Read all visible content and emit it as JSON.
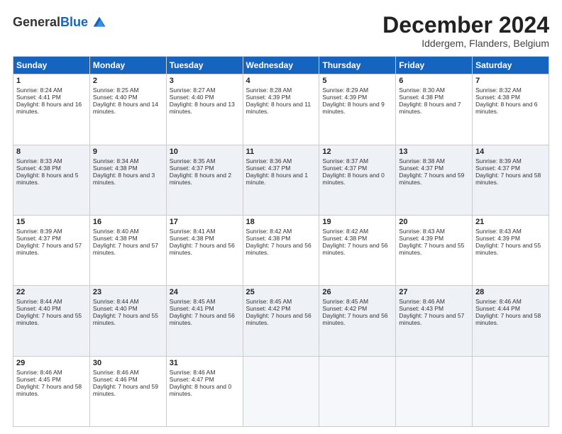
{
  "logo": {
    "line1": "General",
    "line2": "Blue"
  },
  "header": {
    "month": "December 2024",
    "location": "Iddergem, Flanders, Belgium"
  },
  "days_of_week": [
    "Sunday",
    "Monday",
    "Tuesday",
    "Wednesday",
    "Thursday",
    "Friday",
    "Saturday"
  ],
  "weeks": [
    [
      {
        "day": "1",
        "sunrise": "Sunrise: 8:24 AM",
        "sunset": "Sunset: 4:41 PM",
        "daylight": "Daylight: 8 hours and 16 minutes."
      },
      {
        "day": "2",
        "sunrise": "Sunrise: 8:25 AM",
        "sunset": "Sunset: 4:40 PM",
        "daylight": "Daylight: 8 hours and 14 minutes."
      },
      {
        "day": "3",
        "sunrise": "Sunrise: 8:27 AM",
        "sunset": "Sunset: 4:40 PM",
        "daylight": "Daylight: 8 hours and 13 minutes."
      },
      {
        "day": "4",
        "sunrise": "Sunrise: 8:28 AM",
        "sunset": "Sunset: 4:39 PM",
        "daylight": "Daylight: 8 hours and 11 minutes."
      },
      {
        "day": "5",
        "sunrise": "Sunrise: 8:29 AM",
        "sunset": "Sunset: 4:39 PM",
        "daylight": "Daylight: 8 hours and 9 minutes."
      },
      {
        "day": "6",
        "sunrise": "Sunrise: 8:30 AM",
        "sunset": "Sunset: 4:38 PM",
        "daylight": "Daylight: 8 hours and 7 minutes."
      },
      {
        "day": "7",
        "sunrise": "Sunrise: 8:32 AM",
        "sunset": "Sunset: 4:38 PM",
        "daylight": "Daylight: 8 hours and 6 minutes."
      }
    ],
    [
      {
        "day": "8",
        "sunrise": "Sunrise: 8:33 AM",
        "sunset": "Sunset: 4:38 PM",
        "daylight": "Daylight: 8 hours and 5 minutes."
      },
      {
        "day": "9",
        "sunrise": "Sunrise: 8:34 AM",
        "sunset": "Sunset: 4:38 PM",
        "daylight": "Daylight: 8 hours and 3 minutes."
      },
      {
        "day": "10",
        "sunrise": "Sunrise: 8:35 AM",
        "sunset": "Sunset: 4:37 PM",
        "daylight": "Daylight: 8 hours and 2 minutes."
      },
      {
        "day": "11",
        "sunrise": "Sunrise: 8:36 AM",
        "sunset": "Sunset: 4:37 PM",
        "daylight": "Daylight: 8 hours and 1 minute."
      },
      {
        "day": "12",
        "sunrise": "Sunrise: 8:37 AM",
        "sunset": "Sunset: 4:37 PM",
        "daylight": "Daylight: 8 hours and 0 minutes."
      },
      {
        "day": "13",
        "sunrise": "Sunrise: 8:38 AM",
        "sunset": "Sunset: 4:37 PM",
        "daylight": "Daylight: 7 hours and 59 minutes."
      },
      {
        "day": "14",
        "sunrise": "Sunrise: 8:39 AM",
        "sunset": "Sunset: 4:37 PM",
        "daylight": "Daylight: 7 hours and 58 minutes."
      }
    ],
    [
      {
        "day": "15",
        "sunrise": "Sunrise: 8:39 AM",
        "sunset": "Sunset: 4:37 PM",
        "daylight": "Daylight: 7 hours and 57 minutes."
      },
      {
        "day": "16",
        "sunrise": "Sunrise: 8:40 AM",
        "sunset": "Sunset: 4:38 PM",
        "daylight": "Daylight: 7 hours and 57 minutes."
      },
      {
        "day": "17",
        "sunrise": "Sunrise: 8:41 AM",
        "sunset": "Sunset: 4:38 PM",
        "daylight": "Daylight: 7 hours and 56 minutes."
      },
      {
        "day": "18",
        "sunrise": "Sunrise: 8:42 AM",
        "sunset": "Sunset: 4:38 PM",
        "daylight": "Daylight: 7 hours and 56 minutes."
      },
      {
        "day": "19",
        "sunrise": "Sunrise: 8:42 AM",
        "sunset": "Sunset: 4:38 PM",
        "daylight": "Daylight: 7 hours and 56 minutes."
      },
      {
        "day": "20",
        "sunrise": "Sunrise: 8:43 AM",
        "sunset": "Sunset: 4:39 PM",
        "daylight": "Daylight: 7 hours and 55 minutes."
      },
      {
        "day": "21",
        "sunrise": "Sunrise: 8:43 AM",
        "sunset": "Sunset: 4:39 PM",
        "daylight": "Daylight: 7 hours and 55 minutes."
      }
    ],
    [
      {
        "day": "22",
        "sunrise": "Sunrise: 8:44 AM",
        "sunset": "Sunset: 4:40 PM",
        "daylight": "Daylight: 7 hours and 55 minutes."
      },
      {
        "day": "23",
        "sunrise": "Sunrise: 8:44 AM",
        "sunset": "Sunset: 4:40 PM",
        "daylight": "Daylight: 7 hours and 55 minutes."
      },
      {
        "day": "24",
        "sunrise": "Sunrise: 8:45 AM",
        "sunset": "Sunset: 4:41 PM",
        "daylight": "Daylight: 7 hours and 56 minutes."
      },
      {
        "day": "25",
        "sunrise": "Sunrise: 8:45 AM",
        "sunset": "Sunset: 4:42 PM",
        "daylight": "Daylight: 7 hours and 56 minutes."
      },
      {
        "day": "26",
        "sunrise": "Sunrise: 8:45 AM",
        "sunset": "Sunset: 4:42 PM",
        "daylight": "Daylight: 7 hours and 56 minutes."
      },
      {
        "day": "27",
        "sunrise": "Sunrise: 8:46 AM",
        "sunset": "Sunset: 4:43 PM",
        "daylight": "Daylight: 7 hours and 57 minutes."
      },
      {
        "day": "28",
        "sunrise": "Sunrise: 8:46 AM",
        "sunset": "Sunset: 4:44 PM",
        "daylight": "Daylight: 7 hours and 58 minutes."
      }
    ],
    [
      {
        "day": "29",
        "sunrise": "Sunrise: 8:46 AM",
        "sunset": "Sunset: 4:45 PM",
        "daylight": "Daylight: 7 hours and 58 minutes."
      },
      {
        "day": "30",
        "sunrise": "Sunrise: 8:46 AM",
        "sunset": "Sunset: 4:46 PM",
        "daylight": "Daylight: 7 hours and 59 minutes."
      },
      {
        "day": "31",
        "sunrise": "Sunrise: 8:46 AM",
        "sunset": "Sunset: 4:47 PM",
        "daylight": "Daylight: 8 hours and 0 minutes."
      },
      null,
      null,
      null,
      null
    ]
  ]
}
